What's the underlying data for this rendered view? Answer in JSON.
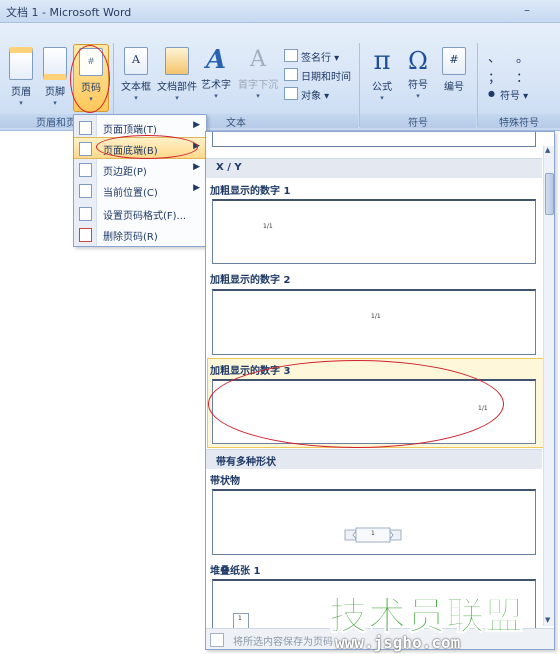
{
  "window": {
    "title": "文档 1 - Microsoft Word",
    "minimize_glyph": "–"
  },
  "ribbon": {
    "groups": {
      "header_footer": {
        "label": "页眉和页",
        "buttons": [
          {
            "label": "页眉",
            "icon": "header-icon"
          },
          {
            "label": "页脚",
            "icon": "footer-icon"
          },
          {
            "label": "页码",
            "icon": "page-number-icon",
            "active": true
          }
        ]
      },
      "text": {
        "label": "文本",
        "buttons": [
          {
            "label": "文本框",
            "icon": "text-box-icon"
          },
          {
            "label": "文档部件",
            "icon": "quick-parts-icon"
          },
          {
            "label": "艺术字",
            "icon": "wordart-icon"
          },
          {
            "label": "首字下沉",
            "icon": "drop-cap-icon"
          }
        ],
        "small_items": [
          {
            "label": "签名行 ▾",
            "icon": "signature-line-icon"
          },
          {
            "label": "日期和时间",
            "icon": "date-time-icon"
          },
          {
            "label": "对象 ▾",
            "icon": "object-icon"
          }
        ]
      },
      "symbols": {
        "label": "符号",
        "buttons": [
          {
            "label": "公式",
            "icon": "pi-icon",
            "glyph": "π"
          },
          {
            "label": "符号",
            "icon": "omega-icon",
            "glyph": "Ω"
          },
          {
            "label": "编号",
            "icon": "number-icon",
            "glyph": "#"
          }
        ]
      },
      "special_symbols": {
        "label": "特殊符号",
        "glyphs": [
          "、",
          "。",
          "；",
          "：",
          "●"
        ],
        "menu_label": "符号 ▾"
      }
    }
  },
  "context_menu": {
    "items": [
      {
        "label": "页面顶端(T)",
        "has_submenu": true,
        "icon": "page-top-icon"
      },
      {
        "label": "页面底端(B)",
        "has_submenu": true,
        "highlighted": true,
        "icon": "page-bottom-icon"
      },
      {
        "label": "页边距(P)",
        "has_submenu": true,
        "icon": "page-margin-icon"
      },
      {
        "label": "当前位置(C)",
        "has_submenu": true,
        "icon": "current-position-icon"
      },
      {
        "label": "设置页码格式(F)...",
        "has_submenu": false,
        "icon": "format-page-number-icon"
      },
      {
        "label": "删除页码(R)",
        "has_submenu": false,
        "icon": "remove-page-number-icon"
      }
    ]
  },
  "gallery": {
    "sections": [
      {
        "heading": "X / Y",
        "items": [
          {
            "title": "加粗显示的数字 1",
            "sample": "1/1"
          },
          {
            "title": "加粗显示的数字 2",
            "sample": "1/1"
          },
          {
            "title": "加粗显示的数字 3",
            "sample": "1/1",
            "selected": true
          }
        ]
      },
      {
        "heading": "带有多种形状",
        "items": [
          {
            "title": "带状物",
            "sample": "1"
          },
          {
            "title": "堆叠纸张 1",
            "sample": "1"
          }
        ]
      }
    ],
    "footer": "将所选内容保存为页码"
  },
  "watermark": {
    "text": "技术员联盟",
    "url": "www.jsgho.com"
  },
  "colors": {
    "ribbon_bg": "#d6e4f6",
    "highlight": "#ffd98b",
    "annotation_red": "#d0202c",
    "watermark_green": "#3aa132"
  }
}
